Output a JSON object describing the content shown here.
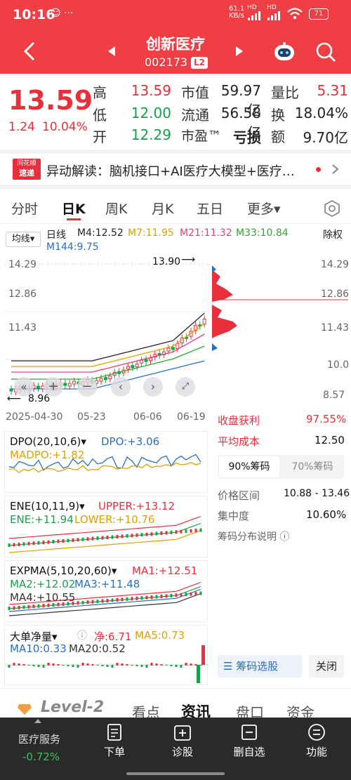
{
  "status_bar": {
    "time": "10:16",
    "net_speed": "61.1",
    "net_unit": "KB/s",
    "battery": "71",
    "sig1": "HD",
    "sig2": "HD"
  },
  "header": {
    "stock_name": "创新医疗",
    "stock_code": "002173",
    "badge": "L2"
  },
  "quote": {
    "price": "13.59",
    "change": "1.24",
    "change_pct": "10.04%",
    "high_label": "高",
    "high": "13.59",
    "low_label": "低",
    "low": "12.00",
    "open_label": "开",
    "open": "12.29",
    "mktcap_label": "市值",
    "mktcap": "59.97亿",
    "float_label": "流通",
    "float": "56.58亿",
    "pe_label": "市盈™",
    "pe": "亏损",
    "vol_ratio_label": "量比",
    "vol_ratio": "5.31",
    "turnover_label": "换",
    "turnover": "18.04%",
    "amount_label": "额",
    "amount": "9.70亿"
  },
  "news": {
    "logo_top": "同花顺",
    "logo_bottom": "速递",
    "text": "异动解读：脑机接口+AI医疗大模型+医疗…"
  },
  "tabs": [
    "分时",
    "日K",
    "周K",
    "月K",
    "五日",
    "更多▾"
  ],
  "active_tab": 1,
  "kline": {
    "ma_selector": "均线▾",
    "period": "日线",
    "m4": "M4:12.52",
    "m7": "M7:11.95",
    "m21": "M21:11.32",
    "m33": "M33:10.84",
    "m144": "M144:9.75",
    "rights": "除权",
    "y_ticks": [
      "14.29",
      "12.86",
      "11.43",
      "10.0",
      "8.57"
    ],
    "peak_label": "13.90",
    "low_label": "8.96",
    "dates": [
      "2025-04-30",
      "05-23",
      "06-06",
      "06-19"
    ]
  },
  "chip": {
    "profit_label": "收盘获利",
    "profit": "97.55%",
    "avg_label": "平均成本",
    "avg": "12.50",
    "tab_90": "90%筹码",
    "tab_70": "70%筹码",
    "range_label": "价格区间",
    "range": "10.88 - 13.46",
    "conc_label": "集中度",
    "conc": "10.60%",
    "explain": "筹码分布说明 ⓘ",
    "select_btn": "筹码选股",
    "close_btn": "关闭"
  },
  "indicators": {
    "dpo_name": "DPO(20,10,6)▾",
    "dpo": "DPO:+3.06",
    "madpo": "MADPO:+1.82",
    "ene_name": "ENE(10,11,9)▾",
    "upper": "UPPER:+13.12",
    "ene": "ENE:+11.94",
    "lower": "LOWER:+10.76",
    "expma_name": "EXPMA(5,10,20,60)▾",
    "ma1": "MA1:+12.51",
    "ma2": "MA2:+12.02",
    "ma3": "MA3:+11.48",
    "ma4": "MA4:+10.55",
    "big_name": "大单净量▾",
    "jing": "净:6.71",
    "ma5": "MA5:0.73",
    "ma10": "MA10:0.33",
    "ma20": "MA20:0.52"
  },
  "bottom_tabs": [
    "Level-2",
    "看点",
    "资讯",
    "盘口",
    "资金"
  ],
  "bottom_nav": {
    "sector": "医疗服务",
    "sector_chg": "-0.72%",
    "items": [
      "下单",
      "诊股",
      "删自选",
      "功能"
    ]
  }
}
